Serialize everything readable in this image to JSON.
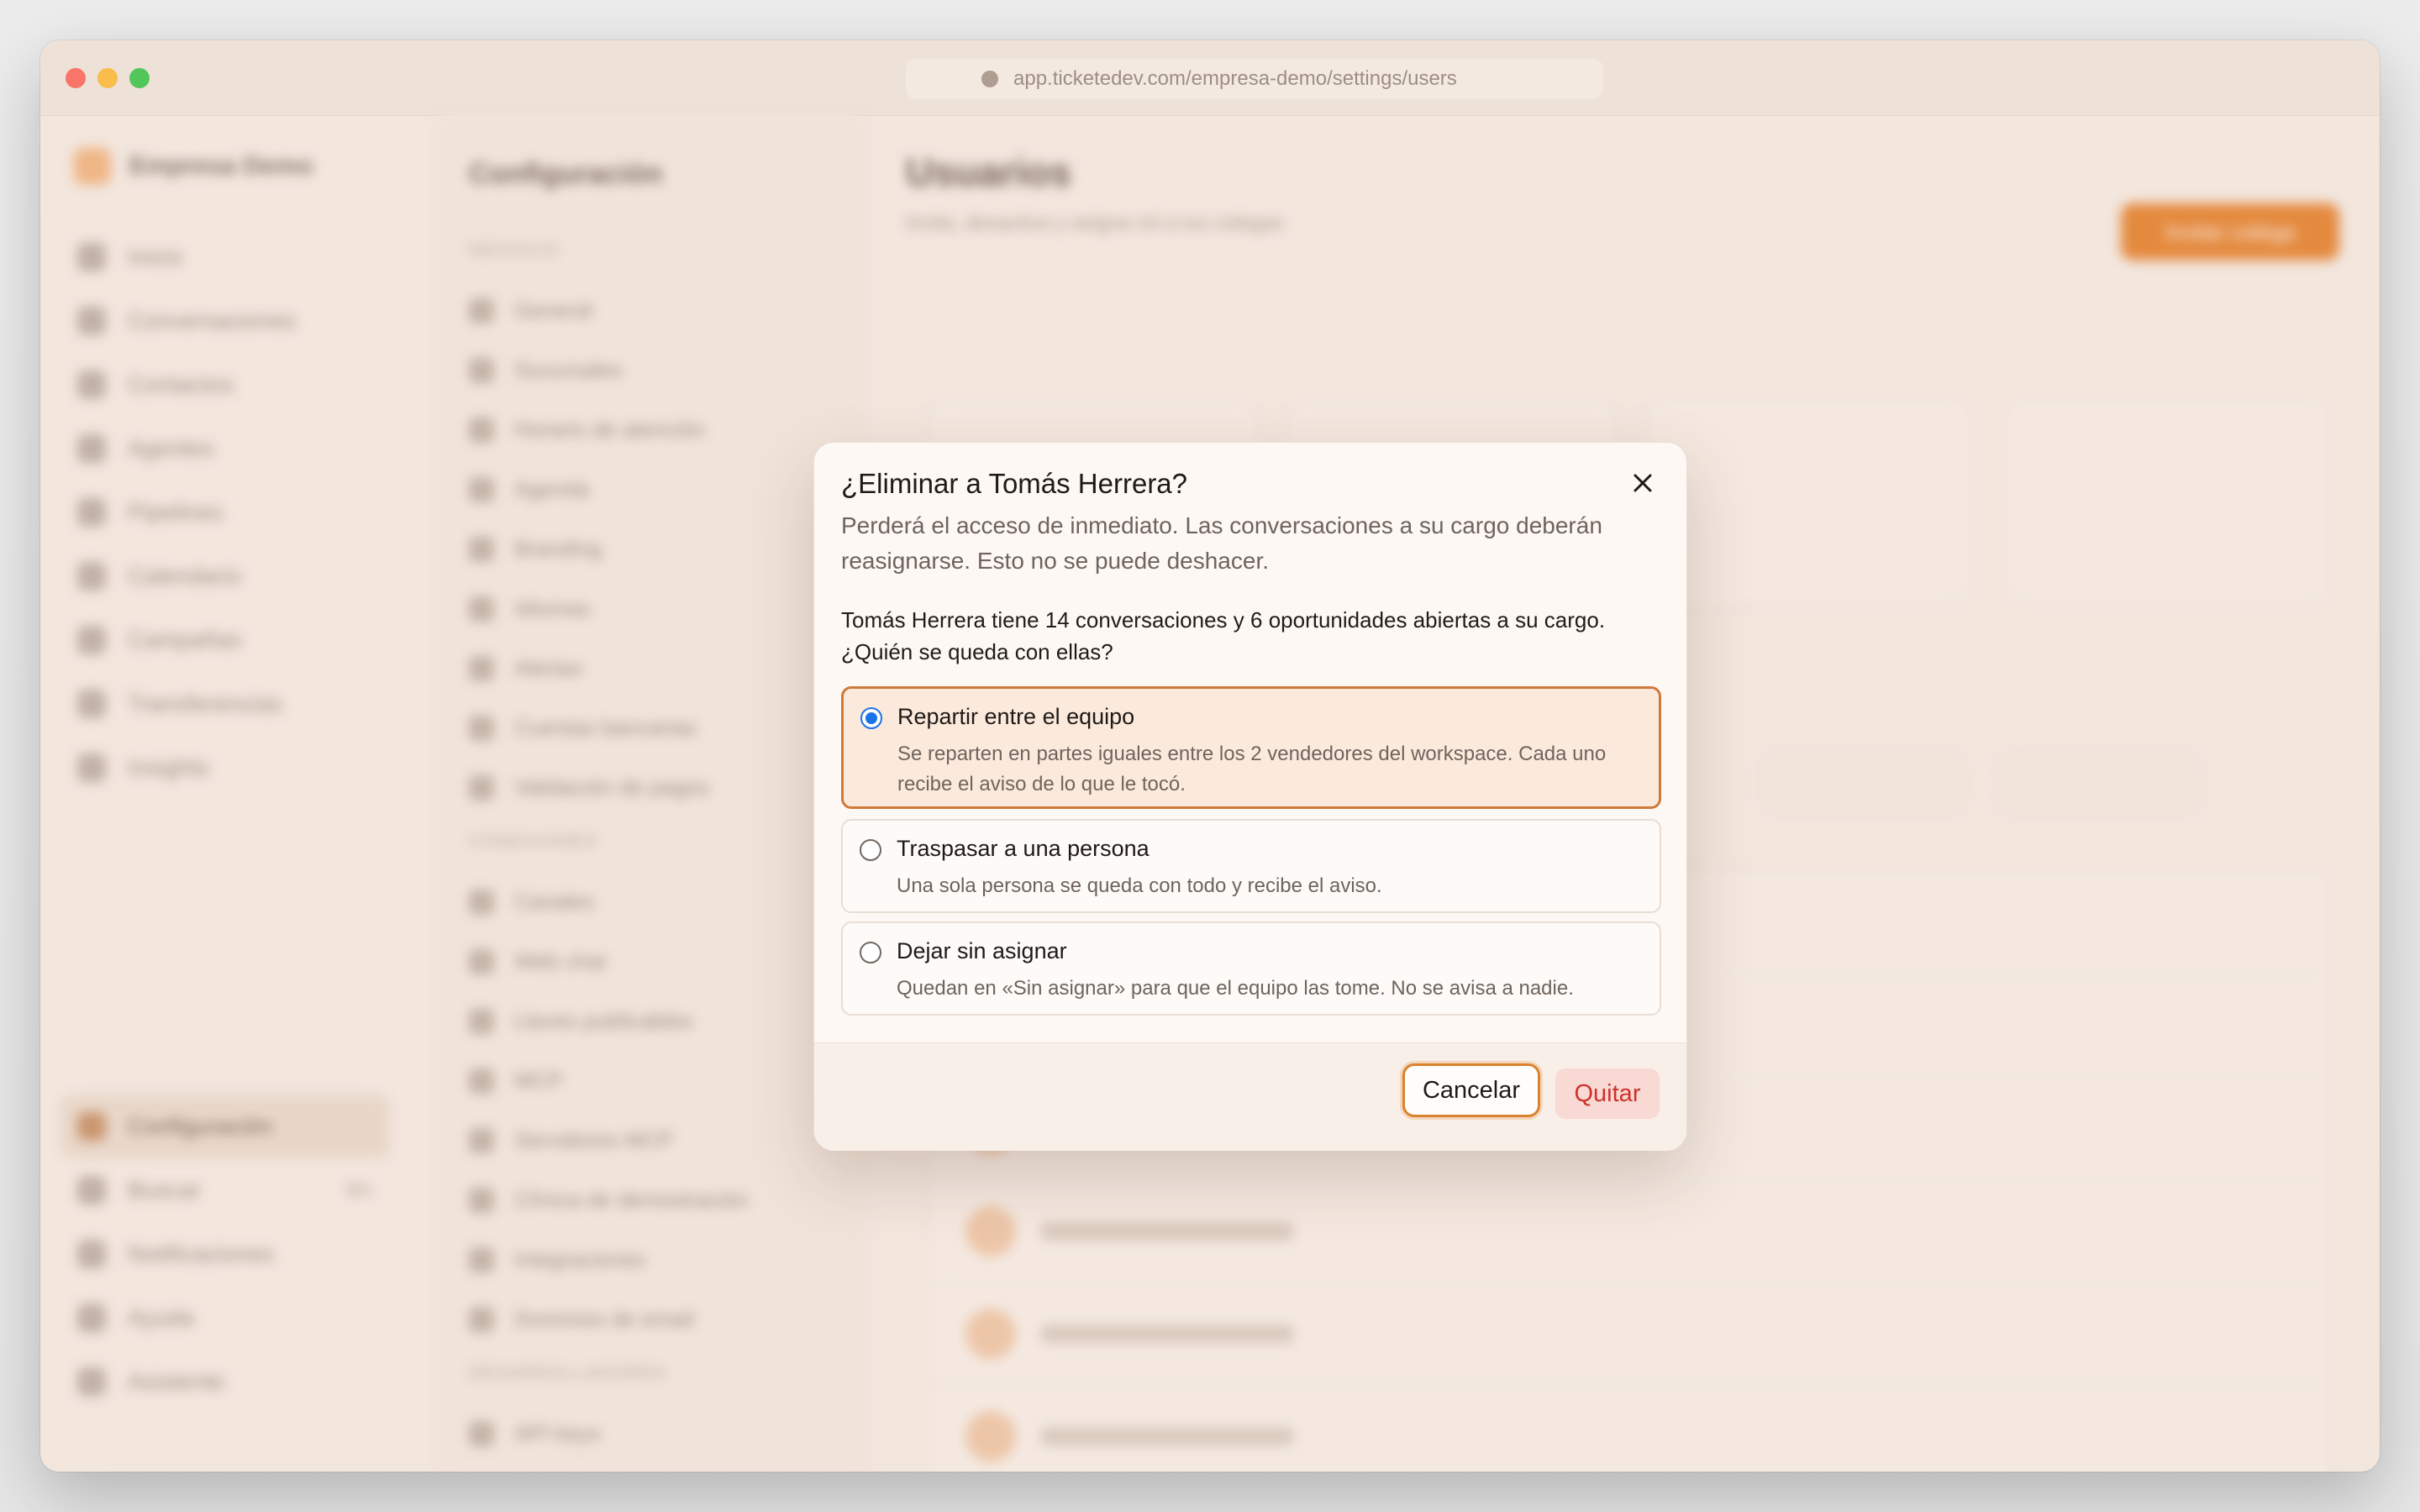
{
  "window": {
    "url": "app.ticketedev.com/empresa-demo/settings/users"
  },
  "sidebar": {
    "brand": "Empresa Demo",
    "items": [
      "Inicio",
      "Conversaciones",
      "Contactos",
      "Agentes",
      "Pipelines",
      "Calendario",
      "Campañas",
      "Transferencias",
      "Insights"
    ],
    "bottom_items": [
      "Configuración",
      "Buscar",
      "Notificaciones",
      "Ayuda",
      "Asistente"
    ],
    "search_shortcut": "⌘K"
  },
  "settings": {
    "title": "Configuración",
    "sections": [
      {
        "label": "NEGOCIO",
        "items": [
          "General",
          "Sucursales",
          "Horario de atención",
          "Agenda",
          "Branding",
          "Idiomas",
          "Alertas",
          "Cuentas bancarias",
          "Validación de pagos"
        ]
      },
      {
        "label": "CONEXIONES",
        "items": [
          "Canales",
          "Web chat",
          "Llaves publicables",
          "MCP",
          "Servidores MCP",
          "Clínica de demostración",
          "Integraciones",
          "Dominios de email"
        ]
      },
      {
        "label": "DESARROLLADORES",
        "items": [
          "API keys"
        ]
      }
    ]
  },
  "main": {
    "title": "Usuarios",
    "subtitle": "Invita, desactiva y asigna rol a tus colegas",
    "invite_label": "Invitar colega"
  },
  "modal": {
    "title": "¿Eliminar a Tomás Herrera?",
    "description": "Perderá el acceso de inmediato. Las conversaciones a su cargo deberán reasignarse. Esto no se puede deshacer.",
    "question": "Tomás Herrera tiene 14 conversaciones y 6 oportunidades abiertas a su cargo. ¿Quién se queda con ellas?",
    "options": [
      {
        "label": "Repartir entre el equipo",
        "description": "Se reparten en partes iguales entre los 2 vendedores del workspace. Cada uno recibe el aviso de lo que le tocó.",
        "selected": true
      },
      {
        "label": "Traspasar a una persona",
        "description": "Una sola persona se queda con todo y recibe el aviso.",
        "selected": false
      },
      {
        "label": "Dejar sin asignar",
        "description": "Quedan en «Sin asignar» para que el equipo las tome. No se avisa a nadie.",
        "selected": false
      }
    ],
    "cancel_label": "Cancelar",
    "confirm_label": "Quitar"
  },
  "colors": {
    "accent": "#e57a1f",
    "selected_border": "#d07a3a",
    "selected_bg": "#fbe9dc",
    "danger_text": "#d0312d",
    "danger_bg": "#f8d9d3",
    "radio_checked": "#1a73e8"
  }
}
